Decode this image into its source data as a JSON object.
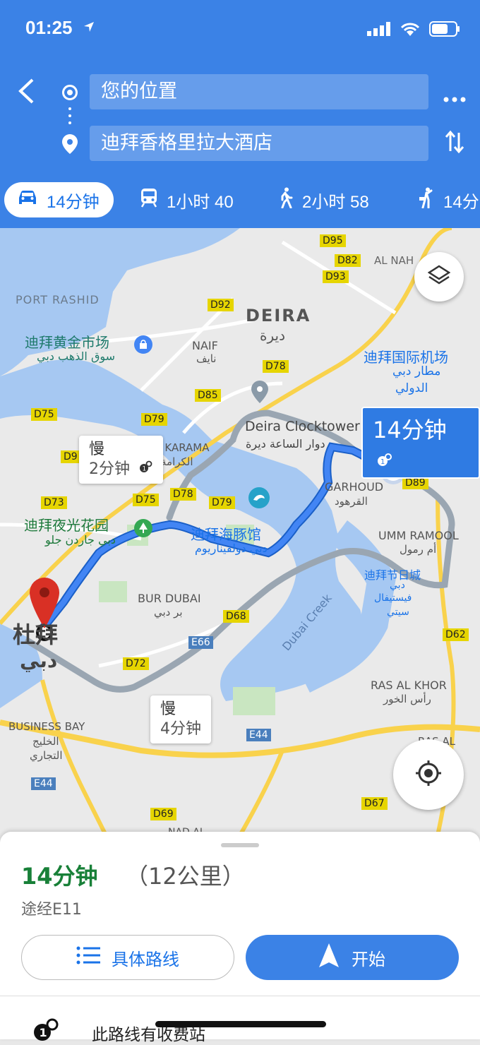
{
  "status": {
    "time": "01:25"
  },
  "header": {
    "origin": "您的位置",
    "destination": "迪拜香格里拉大酒店"
  },
  "modes": [
    {
      "icon": "car-icon",
      "label": "14分钟"
    },
    {
      "icon": "train-icon",
      "label": "1小时 40"
    },
    {
      "icon": "walk-icon",
      "label": "2小时 58"
    },
    {
      "icon": "rideshare-icon",
      "label": "14分"
    }
  ],
  "map": {
    "route_time": "14分钟",
    "alt1_slow": "慢",
    "alt1_time": "2分钟",
    "alt2_slow": "慢",
    "alt2_time": "4分钟",
    "labels": {
      "port_rashid": "PORT RASHID",
      "deira": "DEIRA",
      "deira_ar": "ديرة",
      "gold_souk": "迪拜黄金市场",
      "gold_souk_ar": "سوق الذهب دبي",
      "naif": "NAIF",
      "naif_ar": "نايف",
      "airport": "迪拜国际机场",
      "airport_ar1": "مطار دبي",
      "airport_ar2": "الدولي",
      "clocktower": "Deira Clocktower",
      "clocktower_ar": "دوار الساعة ديرة",
      "karama": "AL KARAMA",
      "karama_ar": "الكرامة",
      "garhoud": "GARHOUD",
      "garhoud_ar": "القرهود",
      "garden_glow": "迪拜夜光花园",
      "garden_glow_ar": "دبي جاردن جلو",
      "dolphinarium": "迪拜海豚馆",
      "dolphinarium_ar": "دبي دولفيناريوم",
      "umm_ramool": "UMM RAMOOL",
      "umm_ramool_ar": "أم رمول",
      "festival_city": "迪拜节日城",
      "festival_ar1": "دبي",
      "festival_ar2": "فيستيفال",
      "festival_ar3": "سيتي",
      "bur_dubai": "BUR DUBAI",
      "bur_dubai_ar": "بر دبي",
      "dubai": "杜拜",
      "dubai_ar": "دبي",
      "dubai_creek": "Dubai Creek",
      "ras_al_khor": "RAS AL KHOR",
      "ras_al_khor_ar": "رأس الخور",
      "business_bay": "BUSINESS BAY",
      "business_bay_ar1": "الخليج",
      "business_bay_ar2": "التجاري",
      "al_nahda": "AL NAH",
      "nad_al_sheba": "NAD AL",
      "al_khor_edge": "RAS AL KHO"
    },
    "road_shields": [
      "D95",
      "D82",
      "D93",
      "D92",
      "D78",
      "D85",
      "D75",
      "D79",
      "D9",
      "D78",
      "D73",
      "D75",
      "D79",
      "D89",
      "D68",
      "D62",
      "E66",
      "D72",
      "E44",
      "E44",
      "D67",
      "D69"
    ]
  },
  "sheet": {
    "duration": "14分钟",
    "distance": "（12公里）",
    "via": "途经E11",
    "details_label": "具体路线",
    "start_label": "开始",
    "toll_text": "此路线有收费站"
  },
  "colors": {
    "header_blue": "#3b82e6",
    "route_blue": "#4285f4",
    "duration_green": "#188038",
    "pin_red": "#d93025"
  }
}
